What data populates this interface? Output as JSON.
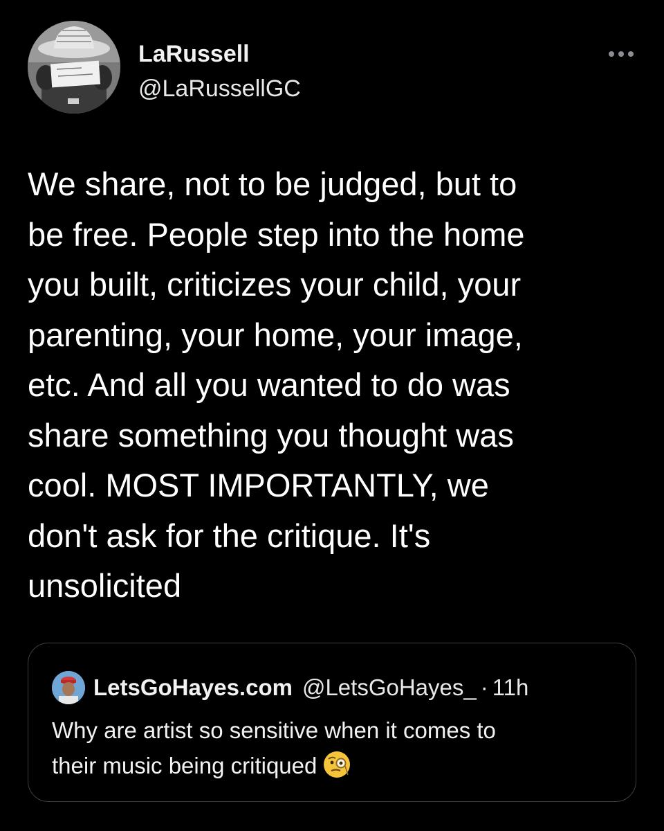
{
  "tweet": {
    "author": {
      "name": "LaRussell",
      "handle": "@LaRussellGC"
    },
    "text_lines": [
      "We share, not to be judged, but to",
      "be free. People step into the home",
      "you built, criticizes your child, your",
      "parenting, your home, your image,",
      "etc. And all you wanted to do was",
      "share something you thought was",
      "cool. MOST IMPORTANTLY, we",
      "don't ask for the critique. It's",
      "unsolicited"
    ]
  },
  "quoted_tweet": {
    "author_name": "LetsGoHayes.com",
    "author_handle": "@LetsGoHayes_",
    "separator": "·",
    "time": "11h",
    "text_lines": [
      "Why are artist so sensitive when it comes to",
      "their music being critiqued"
    ],
    "emoji": "face-with-monocle-icon"
  },
  "colors": {
    "background": "#000000",
    "text_primary": "#ffffff",
    "text_secondary": "#e7e9ea",
    "border": "#3b3f43",
    "more_dots": "#8b8f94"
  }
}
